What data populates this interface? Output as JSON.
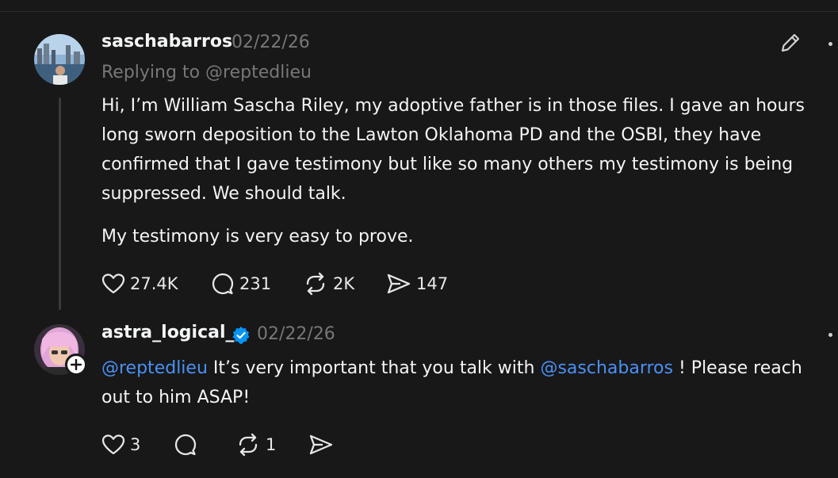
{
  "post1": {
    "username": "saschabarros",
    "date": "02/22/26",
    "replying_prefix": "Replying to ",
    "replying_handle": "@reptedlieu",
    "paragraph1": "Hi, I’m William Sascha Riley, my adoptive father is in those files. I gave an hours long sworn deposition to the Lawton Oklahoma PD and the OSBI, they have confirmed that I gave testimony but like so many others my testimony is being suppressed. We should talk.",
    "paragraph2": "My testimony is very easy to prove.",
    "likes": "27.4K",
    "comments": "231",
    "reposts": "2K",
    "shares": "147"
  },
  "post2": {
    "username": "astra_logical_",
    "date": "02/22/26",
    "mention1": "@reptedlieu",
    "text1": " It’s very important that you talk with ",
    "mention2": "@saschabarros",
    "text2": " ! Please reach out to him ASAP!",
    "likes": "3",
    "reposts": "1"
  },
  "colors": {
    "background": "#181818",
    "text": "#f3f5f7",
    "muted": "#777777",
    "mention": "#4a91f5",
    "verified": "#0095f6"
  }
}
